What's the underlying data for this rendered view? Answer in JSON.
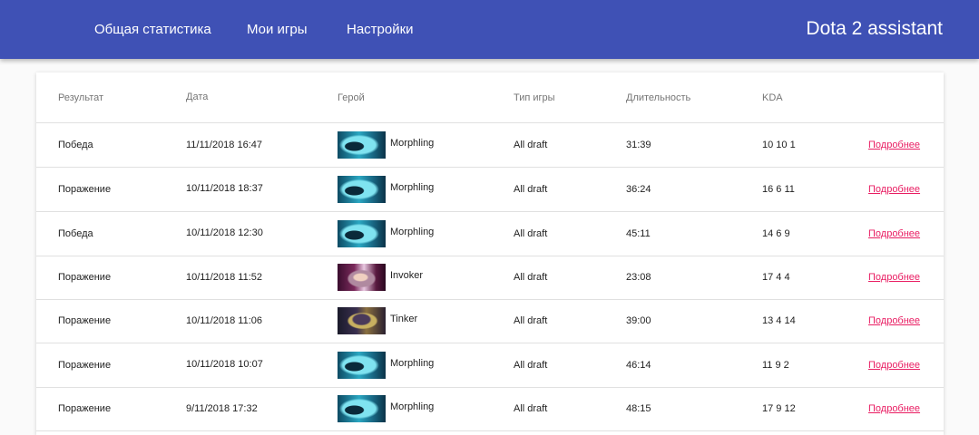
{
  "nav": {
    "links": [
      "Общая статистика",
      "Мои игры",
      "Настройки"
    ],
    "brand": "Dota 2 assistant"
  },
  "table": {
    "headers": {
      "result": "Результат",
      "date": "Дата",
      "hero": "Герой",
      "mode": "Тип игры",
      "duration": "Длительность",
      "kda": "KDA"
    },
    "rows": [
      {
        "result": "Победа",
        "date": "11/11/2018 16:47",
        "hero": "Morphling",
        "hero_icon": "morphling-portrait",
        "mode": "All draft",
        "duration": "31:39",
        "kda": "10 10 1",
        "link": "Подробнее"
      },
      {
        "result": "Поражение",
        "date": "10/11/2018 18:37",
        "hero": "Morphling",
        "hero_icon": "morphling-portrait",
        "mode": "All draft",
        "duration": "36:24",
        "kda": "16 6 11",
        "link": "Подробнее"
      },
      {
        "result": "Победа",
        "date": "10/11/2018 12:30",
        "hero": "Morphling",
        "hero_icon": "morphling-portrait",
        "mode": "All draft",
        "duration": "45:11",
        "kda": "14 6 9",
        "link": "Подробнее"
      },
      {
        "result": "Поражение",
        "date": "10/11/2018 11:52",
        "hero": "Invoker",
        "hero_icon": "invoker-portrait",
        "mode": "All draft",
        "duration": "23:08",
        "kda": "17 4 4",
        "link": "Подробнее"
      },
      {
        "result": "Поражение",
        "date": "10/11/2018 11:06",
        "hero": "Tinker",
        "hero_icon": "tinker-portrait",
        "mode": "All draft",
        "duration": "39:00",
        "kda": "13 4 14",
        "link": "Подробнее"
      },
      {
        "result": "Поражение",
        "date": "10/11/2018 10:07",
        "hero": "Morphling",
        "hero_icon": "morphling-portrait",
        "mode": "All draft",
        "duration": "46:14",
        "kda": "11 9 2",
        "link": "Подробнее"
      },
      {
        "result": "Поражение",
        "date": "9/11/2018 17:32",
        "hero": "Morphling",
        "hero_icon": "morphling-portrait",
        "mode": "All draft",
        "duration": "48:15",
        "kda": "17 9 12",
        "link": "Подробнее"
      }
    ]
  },
  "colors": {
    "navbar": "#3f51b5",
    "link": "#e91e63"
  }
}
